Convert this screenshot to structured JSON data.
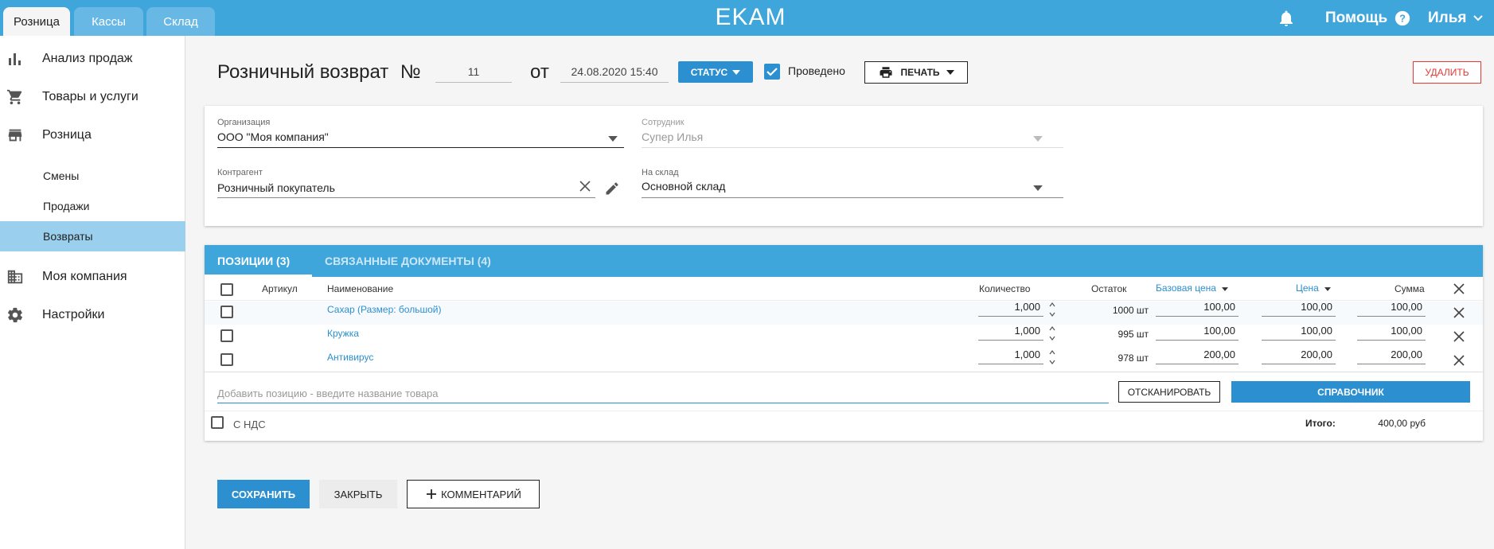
{
  "topbar": {
    "tabs": [
      {
        "label": "Розница"
      },
      {
        "label": "Кассы"
      },
      {
        "label": "Склад"
      }
    ],
    "logo": "EKAM",
    "help_label": "Помощь",
    "user_name": "Илья"
  },
  "sidebar": {
    "items": [
      {
        "label": "Анализ продаж",
        "icon": "bar-chart-icon"
      },
      {
        "label": "Товары и услуги",
        "icon": "cart-icon"
      },
      {
        "label": "Розница",
        "icon": "store-icon"
      },
      {
        "label": "Моя компания",
        "icon": "building-icon"
      },
      {
        "label": "Настройки",
        "icon": "gear-icon"
      }
    ],
    "subitems": [
      {
        "label": "Смены"
      },
      {
        "label": "Продажи"
      },
      {
        "label": "Возвраты",
        "active": true
      }
    ]
  },
  "header": {
    "title": "Розничный возврат",
    "number_sign": "№",
    "number": "11",
    "from_label": "от",
    "date": "24.08.2020 15:40",
    "status_label": "СТАТУС",
    "posted_label": "Проведено",
    "posted": true,
    "print_label": "ПЕЧАТЬ",
    "delete_label": "УДАЛИТЬ"
  },
  "form": {
    "organization_label": "Организация",
    "organization_value": "ООО \"Моя компания\"",
    "employee_label": "Сотрудник",
    "employee_value": "Супер Илья",
    "counterparty_label": "Контрагент",
    "counterparty_value": "Розничный покупатель",
    "warehouse_label": "На склад",
    "warehouse_value": "Основной склад"
  },
  "positions": {
    "tabs": [
      {
        "label": "ПОЗИЦИИ (3)"
      },
      {
        "label": "СВЯЗАННЫЕ ДОКУМЕНТЫ (4)"
      }
    ],
    "columns": {
      "article": "Артикул",
      "name": "Наименование",
      "quantity": "Количество",
      "stock": "Остаток",
      "base_price": "Базовая цена",
      "price": "Цена",
      "sum": "Сумма"
    },
    "rows": [
      {
        "name": "Сахар (Размер: большой)",
        "quantity": "1,000",
        "stock": "1000 шт",
        "base_price": "100,00",
        "price": "100,00",
        "sum": "100,00"
      },
      {
        "name": "Кружка",
        "quantity": "1,000",
        "stock": "995 шт",
        "base_price": "100,00",
        "price": "100,00",
        "sum": "100,00"
      },
      {
        "name": "Антивирус",
        "quantity": "1,000",
        "stock": "978 шт",
        "base_price": "200,00",
        "price": "200,00",
        "sum": "200,00"
      }
    ],
    "add_placeholder": "Добавить позицию - введите название товара",
    "scan_label": "ОТСКАНИРОВАТЬ",
    "catalog_label": "СПРАВОЧНИК",
    "vat_label": "С НДС",
    "total_label": "Итого:",
    "total_value": "400,00 руб"
  },
  "footer": {
    "save_label": "СОХРАНИТЬ",
    "close_label": "ЗАКРЫТЬ",
    "comment_label": "КОММЕНТАРИЙ"
  },
  "colors": {
    "accent": "#3fa6dc",
    "button_primary": "#2b8fd0",
    "link": "#2b8fd0",
    "danger": "#e53935",
    "active_nav": "#9ad0ee"
  }
}
